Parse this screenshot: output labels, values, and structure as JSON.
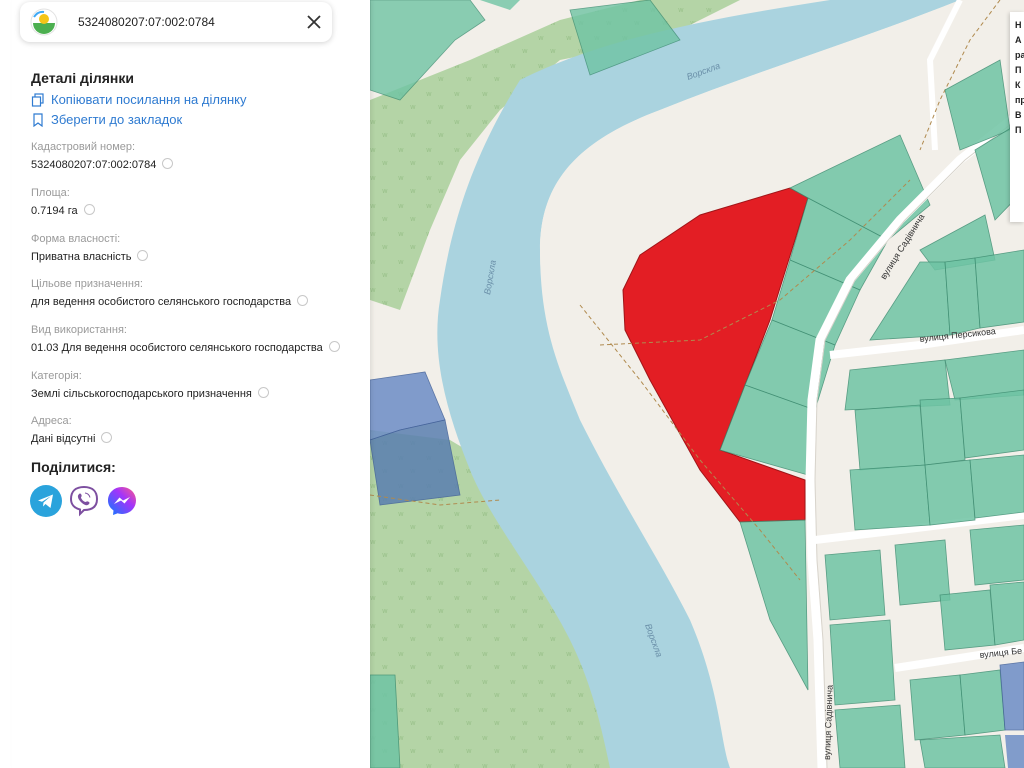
{
  "search": {
    "query": "5324080207:07:002:0784"
  },
  "details": {
    "title": "Деталі ділянки",
    "copy_link": "Копіювати посилання на ділянку",
    "bookmark": "Зберегти до закладок",
    "fields": [
      {
        "label": "Кадастровий номер:",
        "value": "5324080207:07:002:0784"
      },
      {
        "label": "Площа:",
        "value": "0.7194 га"
      },
      {
        "label": "Форма власності:",
        "value": "Приватна власність"
      },
      {
        "label": "Цільове призначення:",
        "value": "для ведення особистого селянського господарства"
      },
      {
        "label": "Вид використання:",
        "value": "01.03 Для ведення особистого селянського господарства"
      },
      {
        "label": "Категорія:",
        "value": "Землі сільськогосподарського призначення"
      },
      {
        "label": "Адреса:",
        "value": "Дані відсутні"
      }
    ]
  },
  "share": {
    "title": "Поділитися:",
    "items": [
      "telegram-icon",
      "viber-icon",
      "messenger-icon"
    ]
  },
  "map": {
    "river_labels": [
      "Ворскла",
      "Ворскла",
      "Ворскла"
    ],
    "streets": [
      "вулиця Садівнича",
      "вулиця Персикова",
      "вулиця Бе",
      "вулиця Садівнича"
    ],
    "colors": {
      "background": "#f2efe9",
      "river": "#aad3df",
      "forest": "#add19e",
      "parcel": "#6fc4a4",
      "selected_parcel": "#e31e24",
      "blue_parcel": "#6d8dc6"
    }
  },
  "popup": {
    "lines": [
      "Н",
      "А",
      "ра",
      "П",
      "К",
      "пр",
      "В",
      "П"
    ]
  }
}
